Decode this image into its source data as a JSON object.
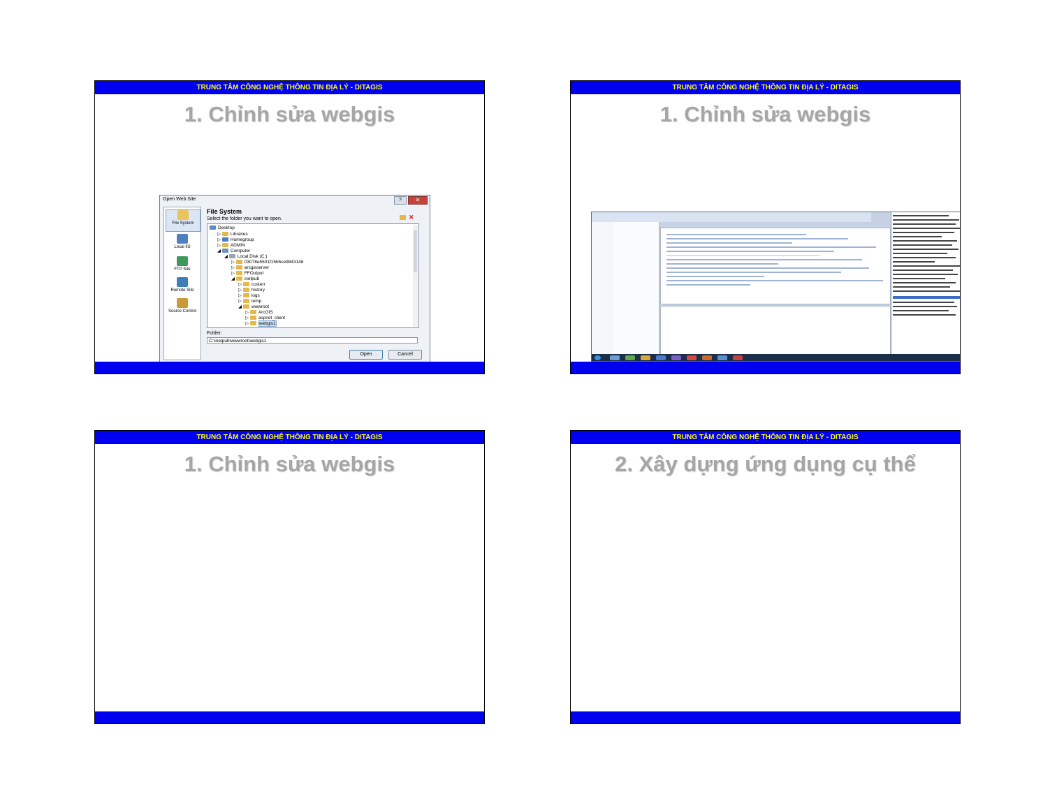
{
  "header_text": "TRUNG TÂM CÔNG NGHỆ THÔNG TIN ĐỊA LÝ - DITAGIS",
  "slides": [
    {
      "title": "1. Chỉnh sửa webgis"
    },
    {
      "title": "1. Chỉnh sửa webgis"
    },
    {
      "title": "1. Chỉnh sửa webgis"
    },
    {
      "title": "2. Xây dựng ứng dụng cụ thể"
    }
  ],
  "dialog": {
    "window_title": "Open Web Site",
    "help_button": "?",
    "close_button": "✕",
    "heading": "File System",
    "subheading": "Select the folder you want to open.",
    "locations": [
      "File System",
      "Local IIS",
      "FTP Site",
      "Remote Site",
      "Source Control"
    ],
    "tree": [
      "Desktop",
      "Libraries",
      "Homegroup",
      "ADMIN",
      "Computer",
      "Local Disk (C:)",
      "03078e5501f15b5ce9843148",
      "arcgisserver",
      "FFOutput",
      "inetpub",
      "custerr",
      "history",
      "logs",
      "temp",
      "wwwroot",
      "ArcGIS",
      "aspnet_client",
      "webgis1"
    ],
    "folder_label": "Folder:",
    "folder_value": "C:\\inetpub\\wwwroot\\webgis1",
    "open_button": "Open",
    "cancel_button": "Cancel"
  },
  "colors": {
    "header_bar": "#0000f0",
    "header_text": "#ffff00",
    "title": "#a6a6a6"
  }
}
